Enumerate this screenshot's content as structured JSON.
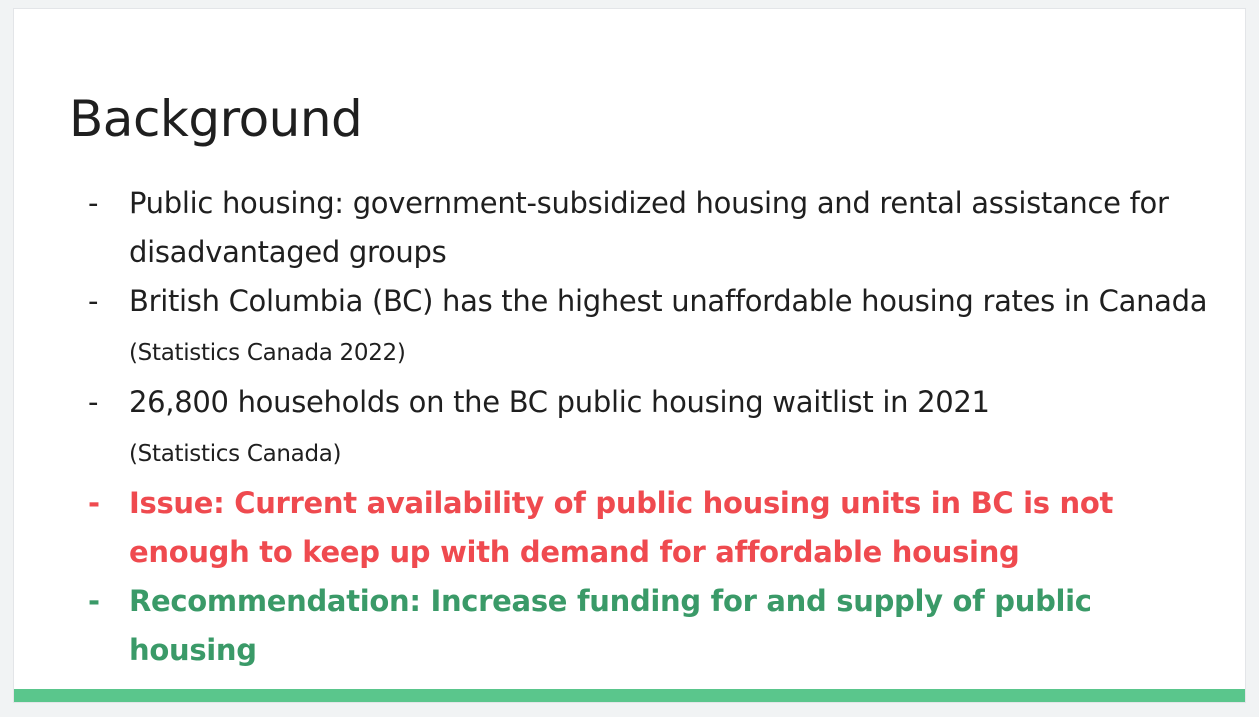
{
  "slide": {
    "title": "Background",
    "bullets": [
      {
        "dash": "-",
        "text": "Public housing: government-subsidized housing and rental assistance for disadvantaged groups",
        "citation": ""
      },
      {
        "dash": "-",
        "text": "British Columbia (BC) has the highest unaffordable housing rates in Canada",
        "citation": "(Statistics Canada 2022)"
      },
      {
        "dash": "-",
        "text": "26,800 households on the BC public housing waitlist in 2021",
        "citation": "(Statistics Canada)"
      },
      {
        "dash": "-",
        "text": "Issue: Current availability of public housing units in BC is not enough to keep up with demand for affordable housing",
        "citation": ""
      },
      {
        "dash": "-",
        "text": "Recommendation: Increase funding for and supply of public housing",
        "citation": ""
      }
    ],
    "colors": {
      "issue": "#ef4a4f",
      "recommendation": "#3a9a68",
      "footer_bar": "#5ac68c"
    }
  }
}
